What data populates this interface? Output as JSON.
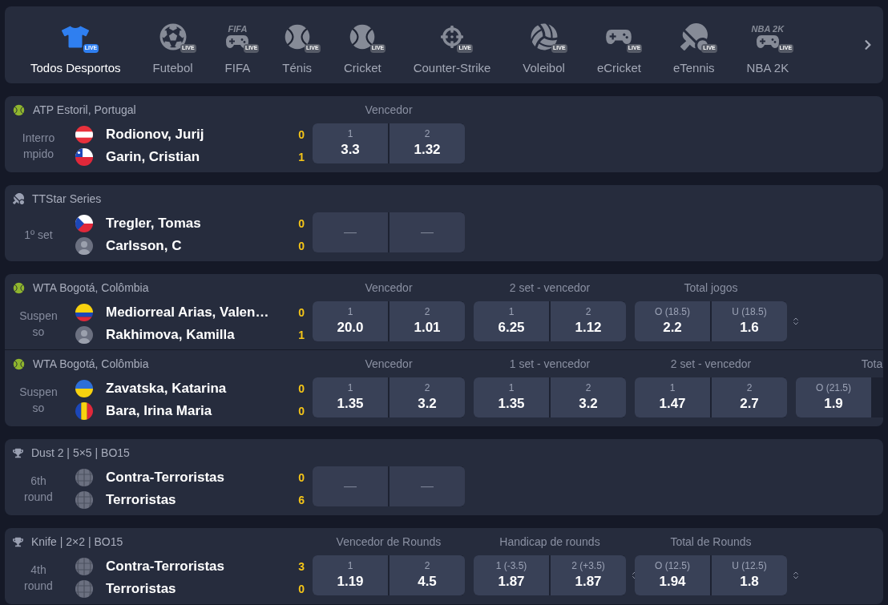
{
  "sports_nav": {
    "items": [
      {
        "label": "Todos Desportos",
        "icon": {
          "kind": "shirt"
        },
        "badge": "LIVE",
        "selected": true
      },
      {
        "label": "Futebol",
        "icon": {
          "kind": "soccer"
        },
        "badge": "LIVE",
        "selected": false
      },
      {
        "label": "FIFA",
        "icon": {
          "kind": "gamepad"
        },
        "logo_text": "FIFA",
        "badge": "LIVE",
        "selected": false
      },
      {
        "label": "Ténis",
        "icon": {
          "kind": "tennis"
        },
        "badge": "LIVE",
        "selected": false
      },
      {
        "label": "Cricket",
        "icon": {
          "kind": "cricket"
        },
        "badge": "LIVE",
        "selected": false
      },
      {
        "label": "Counter-Strike",
        "icon": {
          "kind": "shooter"
        },
        "badge": "LIVE",
        "selected": false
      },
      {
        "label": "Voleibol",
        "icon": {
          "kind": "volleyball"
        },
        "badge": "LIVE",
        "selected": false
      },
      {
        "label": "eCricket",
        "icon": {
          "kind": "ecricket"
        },
        "badge": "LIVE",
        "selected": false
      },
      {
        "label": "eTennis",
        "icon": {
          "kind": "etennis"
        },
        "badge": "LIVE",
        "selected": false
      },
      {
        "label": "NBA 2K",
        "icon": {
          "kind": "gamepad"
        },
        "logo_text": "NBA 2K",
        "badge": "LIVE",
        "selected": false
      }
    ]
  },
  "cards": [
    {
      "events": [
        {
          "league": "ATP Estoril, Portugal",
          "league_icon": {
            "kind": "tennis"
          },
          "status": "Interrompido",
          "teams": [
            {
              "name": "Rodionov, Jurij",
              "flag": {
                "kind": "austria"
              },
              "score": "0"
            },
            {
              "name": "Garin, Cristian",
              "flag": {
                "kind": "chile"
              },
              "score": "1"
            }
          ],
          "markets": [
            {
              "title": "Vencedor",
              "locked": false,
              "toggle": false,
              "odds": [
                {
                  "label": "1",
                  "value": "3.3"
                },
                {
                  "label": "2",
                  "value": "1.32"
                }
              ]
            }
          ]
        }
      ]
    },
    {
      "events": [
        {
          "league": "TTStar Series",
          "league_icon": {
            "kind": "table_tennis"
          },
          "status": "1º set",
          "teams": [
            {
              "name": "Tregler, Tomas",
              "flag": {
                "kind": "czech"
              },
              "score": "0"
            },
            {
              "name": "Carlsson, C",
              "flag": {
                "kind": "generic"
              },
              "score": "0"
            }
          ],
          "markets": [
            {
              "locked": true,
              "toggle": false,
              "odds": [
                {
                  "value": "—"
                },
                {
                  "value": "—"
                }
              ]
            }
          ]
        }
      ]
    },
    {
      "events": [
        {
          "league": "WTA Bogotá, Colômbia",
          "league_icon": {
            "kind": "tennis"
          },
          "status": "Suspenso",
          "teams": [
            {
              "name": "Mediorreal Arias, Valen…",
              "flag": {
                "kind": "colombia"
              },
              "score": "0"
            },
            {
              "name": "Rakhimova, Kamilla",
              "flag": {
                "kind": "generic"
              },
              "score": "1"
            }
          ],
          "markets": [
            {
              "title": "Vencedor",
              "locked": false,
              "toggle": false,
              "odds": [
                {
                  "label": "1",
                  "value": "20.0"
                },
                {
                  "label": "2",
                  "value": "1.01"
                }
              ]
            },
            {
              "title": "2 set - vencedor",
              "locked": false,
              "toggle": false,
              "odds": [
                {
                  "label": "1",
                  "value": "6.25"
                },
                {
                  "label": "2",
                  "value": "1.12"
                }
              ]
            },
            {
              "title": "Total jogos",
              "locked": false,
              "toggle": true,
              "odds": [
                {
                  "label": "O (18.5)",
                  "value": "2.2"
                },
                {
                  "label": "U (18.5)",
                  "value": "1.6"
                }
              ]
            }
          ]
        },
        {
          "league": "WTA Bogotá, Colômbia",
          "league_icon": {
            "kind": "tennis"
          },
          "status": "Suspenso",
          "teams": [
            {
              "name": "Zavatska, Katarina",
              "flag": {
                "kind": "ukraine"
              },
              "score": "0"
            },
            {
              "name": "Bara, Irina Maria",
              "flag": {
                "kind": "romania"
              },
              "score": "0"
            }
          ],
          "markets": [
            {
              "title": "Vencedor",
              "locked": false,
              "toggle": false,
              "odds": [
                {
                  "label": "1",
                  "value": "1.35"
                },
                {
                  "label": "2",
                  "value": "3.2"
                }
              ]
            },
            {
              "title": "1 set - vencedor",
              "locked": false,
              "toggle": false,
              "odds": [
                {
                  "label": "1",
                  "value": "1.35"
                },
                {
                  "label": "2",
                  "value": "3.2"
                }
              ]
            },
            {
              "title": "2 set - vencedor",
              "locked": false,
              "toggle": false,
              "odds": [
                {
                  "label": "1",
                  "value": "1.47"
                },
                {
                  "label": "2",
                  "value": "2.7"
                }
              ]
            },
            {
              "title": "Tota",
              "locked": false,
              "toggle": false,
              "odds": [
                {
                  "label": "O (21.5)",
                  "value": "1.9"
                }
              ]
            }
          ]
        }
      ]
    },
    {
      "events": [
        {
          "league": "Dust 2 | 5×5 | BO15",
          "league_icon": {
            "kind": "trophy"
          },
          "status": "6th round",
          "teams": [
            {
              "name": "Contra-Terroristas",
              "flag": {
                "kind": "globe"
              },
              "score": "0"
            },
            {
              "name": "Terroristas",
              "flag": {
                "kind": "globe"
              },
              "score": "6"
            }
          ],
          "markets": [
            {
              "locked": true,
              "toggle": false,
              "odds": [
                {
                  "value": "—"
                },
                {
                  "value": "—"
                }
              ]
            }
          ]
        }
      ]
    },
    {
      "events": [
        {
          "league": "Knife | 2×2 | BO15",
          "league_icon": {
            "kind": "trophy"
          },
          "status": "4th round",
          "teams": [
            {
              "name": "Contra-Terroristas",
              "flag": {
                "kind": "globe"
              },
              "score": "3"
            },
            {
              "name": "Terroristas",
              "flag": {
                "kind": "globe"
              },
              "score": "0"
            }
          ],
          "markets": [
            {
              "title": "Vencedor de Rounds",
              "locked": false,
              "toggle": false,
              "odds": [
                {
                  "label": "1",
                  "value": "1.19"
                },
                {
                  "label": "2",
                  "value": "4.5"
                }
              ]
            },
            {
              "title": "Handicap de rounds",
              "locked": false,
              "toggle": true,
              "odds": [
                {
                  "label": "1 (-3.5)",
                  "value": "1.87"
                },
                {
                  "label": "2 (+3.5)",
                  "value": "1.87"
                }
              ]
            },
            {
              "title": "Total de Rounds",
              "locked": false,
              "toggle": true,
              "odds": [
                {
                  "label": "O (12.5)",
                  "value": "1.94"
                },
                {
                  "label": "U (12.5)",
                  "value": "1.8"
                }
              ]
            }
          ]
        }
      ]
    }
  ]
}
